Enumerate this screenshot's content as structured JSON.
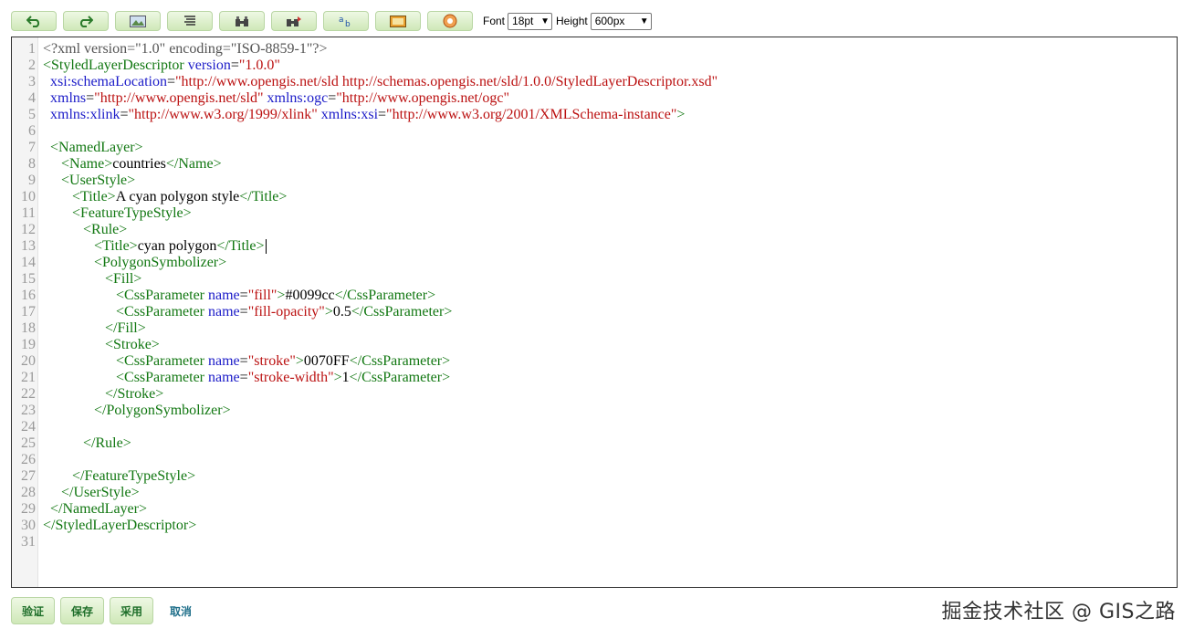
{
  "toolbar": {
    "buttons": [
      {
        "name": "undo-button",
        "icon": "undo-icon"
      },
      {
        "name": "redo-button",
        "icon": "redo-icon"
      },
      {
        "name": "image-button",
        "icon": "image-icon"
      },
      {
        "name": "format-button",
        "icon": "lines-icon"
      },
      {
        "name": "search-button",
        "icon": "binoculars-icon"
      },
      {
        "name": "replace-button",
        "icon": "binoculars-replace-icon"
      },
      {
        "name": "charmap-button",
        "icon": "charmap-icon"
      },
      {
        "name": "preview-button",
        "icon": "frame-icon"
      },
      {
        "name": "help-button",
        "icon": "help-icon"
      }
    ],
    "font_label": "Font",
    "font_value": "18pt",
    "height_label": "Height",
    "height_value": "600px"
  },
  "editor": {
    "line_numbers": [
      "1",
      "2",
      "3",
      "4",
      "5",
      "6",
      "7",
      "8",
      "9",
      "10",
      "11",
      "12",
      "13",
      "14",
      "15",
      "16",
      "17",
      "18",
      "19",
      "20",
      "21",
      "22",
      "23",
      "24",
      "25",
      "26",
      "27",
      "28",
      "29",
      "30",
      "31"
    ],
    "code": {
      "l1": "<?xml version=\"1.0\" encoding=\"ISO-8859-1\"?>",
      "l2_tag": "<StyledLayerDescriptor",
      "l2_attr": " version",
      "l2_eq": "=",
      "l2_val": "\"1.0.0\"",
      "l3_attr": "  xsi:schemaLocation",
      "l3_eq": "=",
      "l3_val": "\"http://www.opengis.net/sld http://schemas.opengis.net/sld/1.0.0/StyledLayerDescriptor.xsd\"",
      "l4_attr1": "  xmlns",
      "l4_val1": "\"http://www.opengis.net/sld\"",
      "l4_attr2": " xmlns:ogc",
      "l4_val2": "\"http://www.opengis.net/ogc\"",
      "l5_attr1": "  xmlns:xlink",
      "l5_val1": "\"http://www.w3.org/1999/xlink\"",
      "l5_attr2": " xmlns:xsi",
      "l5_val2": "\"http://www.w3.org/2001/XMLSchema-instance\"",
      "l5_close": ">",
      "l7": "  <NamedLayer>",
      "l8_open": "     <Name>",
      "l8_text": "countries",
      "l8_close": "</Name>",
      "l9": "     <UserStyle>",
      "l10_open": "        <Title>",
      "l10_text": "A cyan polygon style",
      "l10_close": "</Title>",
      "l11": "        <FeatureTypeStyle>",
      "l12": "           <Rule>",
      "l13_open": "              <Title>",
      "l13_text": "cyan polygon",
      "l13_close": "</Title>",
      "l14": "              <PolygonSymbolizer>",
      "l15": "                 <Fill>",
      "l16_tag": "                    <CssParameter",
      "l16_attr": " name",
      "l16_val": "\"fill\"",
      "l16_gt": ">",
      "l16_text": "#0099cc",
      "l16_close": "</CssParameter>",
      "l17_tag": "                    <CssParameter",
      "l17_attr": " name",
      "l17_val": "\"fill-opacity\"",
      "l17_gt": ">",
      "l17_text": "0.5",
      "l17_close": "</CssParameter>",
      "l18": "                 </Fill>",
      "l19": "                 <Stroke>",
      "l20_tag": "                    <CssParameter",
      "l20_attr": " name",
      "l20_val": "\"stroke\"",
      "l20_gt": ">",
      "l20_text": "0070FF",
      "l20_close": "</CssParameter>",
      "l21_tag": "                    <CssParameter",
      "l21_attr": " name",
      "l21_val": "\"stroke-width\"",
      "l21_gt": ">",
      "l21_text": "1",
      "l21_close": "</CssParameter>",
      "l22": "                 </Stroke>",
      "l23": "              </PolygonSymbolizer>",
      "l25": "           </Rule>",
      "l27": "        </FeatureTypeStyle>",
      "l28": "     </UserStyle>",
      "l29": "  </NamedLayer>",
      "l30": "</StyledLayerDescriptor>"
    }
  },
  "actions": {
    "validate": "验证",
    "save": "保存",
    "apply": "采用",
    "cancel": "取消"
  },
  "watermark": "掘金技术社区 @ GIS之路",
  "colors": {
    "tag": "#117711",
    "attr": "#1b1bc8",
    "value": "#bb1111",
    "button_bg": "#cfe8b8"
  }
}
